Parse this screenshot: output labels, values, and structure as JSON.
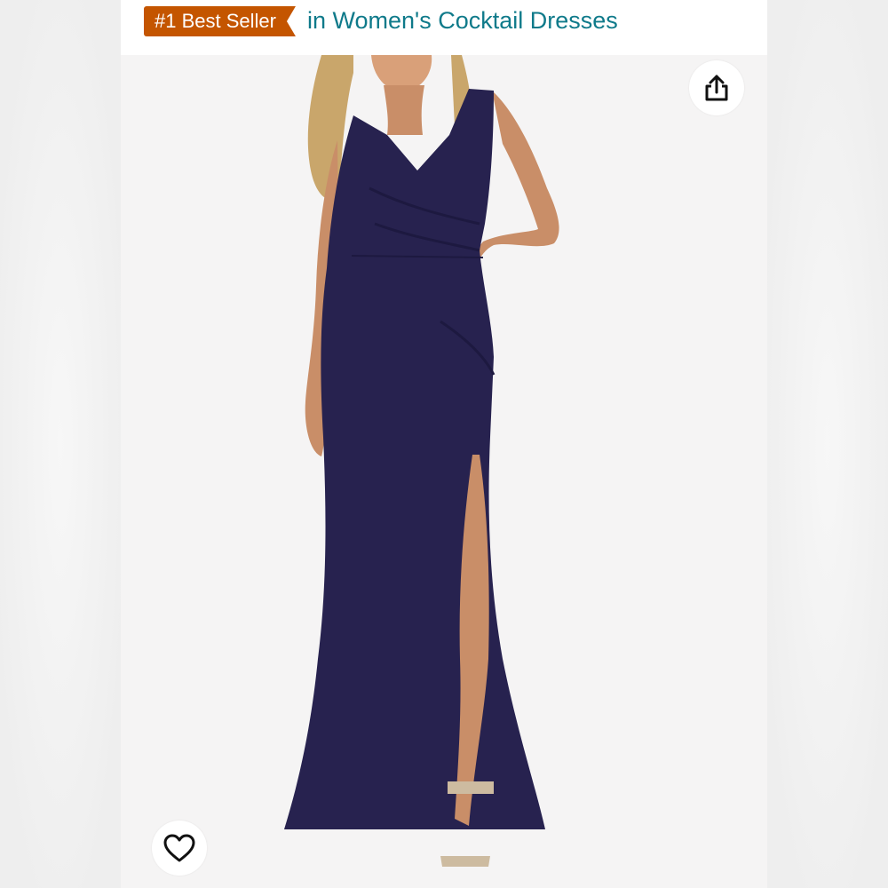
{
  "header": {
    "badge_label": "#1 Best Seller",
    "category_text": "in Women's Cocktail Dresses"
  },
  "product_image": {
    "alt": "navy maxi dress with side slit"
  },
  "icons": {
    "share": "share-icon",
    "wishlist": "heart-icon"
  },
  "colors": {
    "badge": "#c45500",
    "category_link": "#0f7a8a",
    "dress": "#27224f"
  }
}
